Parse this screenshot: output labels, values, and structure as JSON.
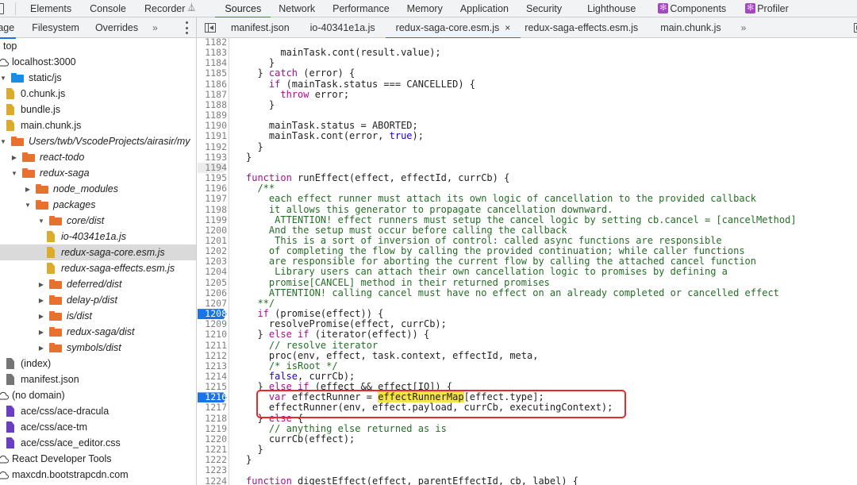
{
  "main_tabs": [
    {
      "label": "Elements"
    },
    {
      "label": "Console"
    },
    {
      "label": "Recorder"
    },
    {
      "label": "Sources",
      "active": true
    },
    {
      "label": "Network"
    },
    {
      "label": "Performance"
    },
    {
      "label": "Memory"
    },
    {
      "label": "Application"
    },
    {
      "label": "Security"
    },
    {
      "label": "Lighthouse"
    },
    {
      "label": "Components"
    },
    {
      "label": "Profiler"
    }
  ],
  "navigator": {
    "tabs": [
      "Page",
      "Filesystem",
      "Overrides"
    ],
    "more": "»",
    "tree": [
      {
        "label": "top",
        "indent": 0,
        "type": "none",
        "arrow": "none"
      },
      {
        "label": "localhost:3000",
        "indent": 0,
        "type": "cloud",
        "arrow": "none"
      },
      {
        "label": "static/js",
        "indent": 0,
        "type": "folder-blue",
        "arrow": "down"
      },
      {
        "label": "0.chunk.js",
        "indent": 1,
        "type": "file-yellow",
        "arrow": "none"
      },
      {
        "label": "bundle.js",
        "indent": 1,
        "type": "file-yellow",
        "arrow": "none"
      },
      {
        "label": "main.chunk.js",
        "indent": 1,
        "type": "file-yellow",
        "arrow": "none"
      },
      {
        "label": "Users/twb/VscodeProjects/airasir/my",
        "indent": 0,
        "type": "folder-orange",
        "arrow": "down",
        "italic": true
      },
      {
        "label": "react-todo",
        "indent": 1,
        "type": "folder-orange",
        "arrow": "right",
        "italic": true
      },
      {
        "label": "redux-saga",
        "indent": 1,
        "type": "folder-orange",
        "arrow": "down",
        "italic": true
      },
      {
        "label": "node_modules",
        "indent": 2,
        "type": "folder-orange",
        "arrow": "right",
        "italic": true
      },
      {
        "label": "packages",
        "indent": 2,
        "type": "folder-orange",
        "arrow": "down",
        "italic": true
      },
      {
        "label": "core/dist",
        "indent": 3,
        "type": "folder-orange",
        "arrow": "down",
        "italic": true
      },
      {
        "label": "io-40341e1a.js",
        "indent": 4,
        "type": "file-yellow",
        "arrow": "none",
        "italic": true
      },
      {
        "label": "redux-saga-core.esm.js",
        "indent": 4,
        "type": "file-yellow",
        "arrow": "none",
        "italic": true,
        "selected": true
      },
      {
        "label": "redux-saga-effects.esm.js",
        "indent": 4,
        "type": "file-yellow",
        "arrow": "none",
        "italic": true
      },
      {
        "label": "deferred/dist",
        "indent": 3,
        "type": "folder-orange",
        "arrow": "right",
        "italic": true
      },
      {
        "label": "delay-p/dist",
        "indent": 3,
        "type": "folder-orange",
        "arrow": "right",
        "italic": true
      },
      {
        "label": "is/dist",
        "indent": 3,
        "type": "folder-orange",
        "arrow": "right",
        "italic": true
      },
      {
        "label": "redux-saga/dist",
        "indent": 3,
        "type": "folder-orange",
        "arrow": "right",
        "italic": true
      },
      {
        "label": "symbols/dist",
        "indent": 3,
        "type": "folder-orange",
        "arrow": "right",
        "italic": true
      },
      {
        "label": "(index)",
        "indent": 1,
        "type": "file-gray",
        "arrow": "none"
      },
      {
        "label": "manifest.json",
        "indent": 1,
        "type": "file-gray",
        "arrow": "none"
      },
      {
        "label": "(no domain)",
        "indent": 0,
        "type": "cloud",
        "arrow": "none"
      },
      {
        "label": "ace/css/ace-dracula",
        "indent": 1,
        "type": "file-purple",
        "arrow": "none"
      },
      {
        "label": "ace/css/ace-tm",
        "indent": 1,
        "type": "file-purple",
        "arrow": "none"
      },
      {
        "label": "ace/css/ace_editor.css",
        "indent": 1,
        "type": "file-purple",
        "arrow": "none"
      },
      {
        "label": "React Developer Tools",
        "indent": 0,
        "type": "cloud",
        "arrow": "none"
      },
      {
        "label": "maxcdn.bootstrapcdn.com",
        "indent": 0,
        "type": "cloud",
        "arrow": "none"
      }
    ]
  },
  "editor": {
    "tabs": [
      {
        "label": "manifest.json"
      },
      {
        "label": "io-40341e1a.js"
      },
      {
        "label": "redux-saga-core.esm.js",
        "active": true,
        "closable": true
      },
      {
        "label": "redux-saga-effects.esm.js"
      },
      {
        "label": "main.chunk.js"
      }
    ],
    "more": "»",
    "close_glyph": "×",
    "highlighted_token": "effectRunnerMap",
    "lines": [
      {
        "n": "1182",
        "code": []
      },
      {
        "n": "1183",
        "code": [
          [
            "",
            "      mainTask.cont(result.value);"
          ]
        ]
      },
      {
        "n": "1184",
        "code": [
          [
            "",
            "    }"
          ]
        ]
      },
      {
        "n": "1185",
        "code": [
          [
            "",
            "  } "
          ],
          [
            "kw",
            "catch"
          ],
          [
            "",
            " (error) {"
          ]
        ]
      },
      {
        "n": "1186",
        "code": [
          [
            "",
            "    "
          ],
          [
            "kw",
            "if"
          ],
          [
            "",
            " (mainTask.status === CANCELLED) {"
          ]
        ]
      },
      {
        "n": "1187",
        "code": [
          [
            "",
            "      "
          ],
          [
            "kw",
            "throw"
          ],
          [
            "",
            " error;"
          ]
        ]
      },
      {
        "n": "1188",
        "code": [
          [
            "",
            "    }"
          ]
        ]
      },
      {
        "n": "1189",
        "code": []
      },
      {
        "n": "1190",
        "code": [
          [
            "",
            "    mainTask.status = ABORTED;"
          ]
        ]
      },
      {
        "n": "1191",
        "code": [
          [
            "",
            "    mainTask.cont(error, "
          ],
          [
            "bl",
            "true"
          ],
          [
            "",
            ");"
          ]
        ]
      },
      {
        "n": "1192",
        "code": [
          [
            "",
            "  }"
          ]
        ]
      },
      {
        "n": "1193",
        "code": [
          [
            "",
            "}"
          ]
        ]
      },
      {
        "n": "1194",
        "code": [],
        "exec": true
      },
      {
        "n": "1195",
        "code": [
          [
            "kw",
            "function"
          ],
          [
            "",
            " runEffect(effect, effectId, currCb) {"
          ]
        ]
      },
      {
        "n": "1196",
        "code": [
          [
            "cm",
            "  /**"
          ]
        ]
      },
      {
        "n": "1197",
        "code": [
          [
            "cm",
            "    each effect runner must attach its own logic of cancellation to the provided callback"
          ]
        ]
      },
      {
        "n": "1198",
        "code": [
          [
            "cm",
            "    it allows this generator to propagate cancellation downward."
          ]
        ]
      },
      {
        "n": "1199",
        "code": [
          [
            "cm",
            "     ATTENTION! effect runners must setup the cancel logic by setting cb.cancel = [cancelMethod]"
          ]
        ]
      },
      {
        "n": "1200",
        "code": [
          [
            "cm",
            "    And the setup must occur before calling the callback"
          ]
        ]
      },
      {
        "n": "1201",
        "code": [
          [
            "cm",
            "     This is a sort of inversion of control: called async functions are responsible"
          ]
        ]
      },
      {
        "n": "1202",
        "code": [
          [
            "cm",
            "    of completing the flow by calling the provided continuation; while caller functions"
          ]
        ]
      },
      {
        "n": "1203",
        "code": [
          [
            "cm",
            "    are responsible for aborting the current flow by calling the attached cancel function"
          ]
        ]
      },
      {
        "n": "1204",
        "code": [
          [
            "cm",
            "     Library users can attach their own cancellation logic to promises by defining a"
          ]
        ]
      },
      {
        "n": "1205",
        "code": [
          [
            "cm",
            "    promise[CANCEL] method in their returned promises"
          ]
        ]
      },
      {
        "n": "1206",
        "code": [
          [
            "cm",
            "    ATTENTION! calling cancel must have no effect on an already completed or cancelled effect"
          ]
        ]
      },
      {
        "n": "1207",
        "code": [
          [
            "cm",
            "  **/"
          ]
        ]
      },
      {
        "n": "1208",
        "code": [
          [
            "",
            "  "
          ],
          [
            "kw",
            "if"
          ],
          [
            "",
            " (promise(effect)) {"
          ]
        ],
        "breakpoint": true
      },
      {
        "n": "1209",
        "code": [
          [
            "",
            "    resolvePromise(effect, currCb);"
          ]
        ]
      },
      {
        "n": "1210",
        "code": [
          [
            "",
            "  } "
          ],
          [
            "kw",
            "else if"
          ],
          [
            "",
            " (iterator(effect)) {"
          ]
        ]
      },
      {
        "n": "1211",
        "code": [
          [
            "cm",
            "    // resolve iterator"
          ]
        ]
      },
      {
        "n": "1212",
        "code": [
          [
            "",
            "    proc(env, effect, task.context, effectId, meta,"
          ]
        ]
      },
      {
        "n": "1213",
        "code": [
          [
            "cm",
            "    /* isRoot */"
          ]
        ]
      },
      {
        "n": "1214",
        "code": [
          [
            "",
            "    "
          ],
          [
            "bl",
            "false"
          ],
          [
            "",
            ", currCb);"
          ]
        ]
      },
      {
        "n": "1215",
        "code": [
          [
            "",
            "  } "
          ],
          [
            "kw",
            "else if"
          ],
          [
            "",
            " (effect && effect[IO]) {"
          ]
        ]
      },
      {
        "n": "1216",
        "code": [
          [
            "",
            "    "
          ],
          [
            "kw",
            "var"
          ],
          [
            "",
            " effectRunner = "
          ],
          [
            "hl",
            "effectRunnerMap"
          ],
          [
            "",
            "[effect.type];"
          ]
        ],
        "breakpoint": true
      },
      {
        "n": "1217",
        "code": [
          [
            "",
            "    effectRunner(env, effect.payload, currCb, executingContext);"
          ]
        ]
      },
      {
        "n": "1218",
        "code": [
          [
            "",
            "  } "
          ],
          [
            "kw",
            "else"
          ],
          [
            "",
            " {"
          ]
        ]
      },
      {
        "n": "1219",
        "code": [
          [
            "cm",
            "    // anything else returned as is"
          ]
        ]
      },
      {
        "n": "1220",
        "code": [
          [
            "",
            "    currCb(effect);"
          ]
        ]
      },
      {
        "n": "1221",
        "code": [
          [
            "",
            "  }"
          ]
        ]
      },
      {
        "n": "1222",
        "code": [
          [
            "",
            "}"
          ]
        ]
      },
      {
        "n": "1223",
        "code": []
      },
      {
        "n": "1224",
        "code": [
          [
            "kw",
            "function"
          ],
          [
            "",
            " digestEffect(effect, parentEffectId, cb, label) {"
          ]
        ]
      }
    ]
  },
  "colors": {
    "accent": "#1a73e8",
    "keyword": "#aa0d91",
    "comment": "#236e25",
    "literal": "#1c00cf",
    "highlight": "#f5e34a",
    "annotation_box": "#e8282a"
  }
}
